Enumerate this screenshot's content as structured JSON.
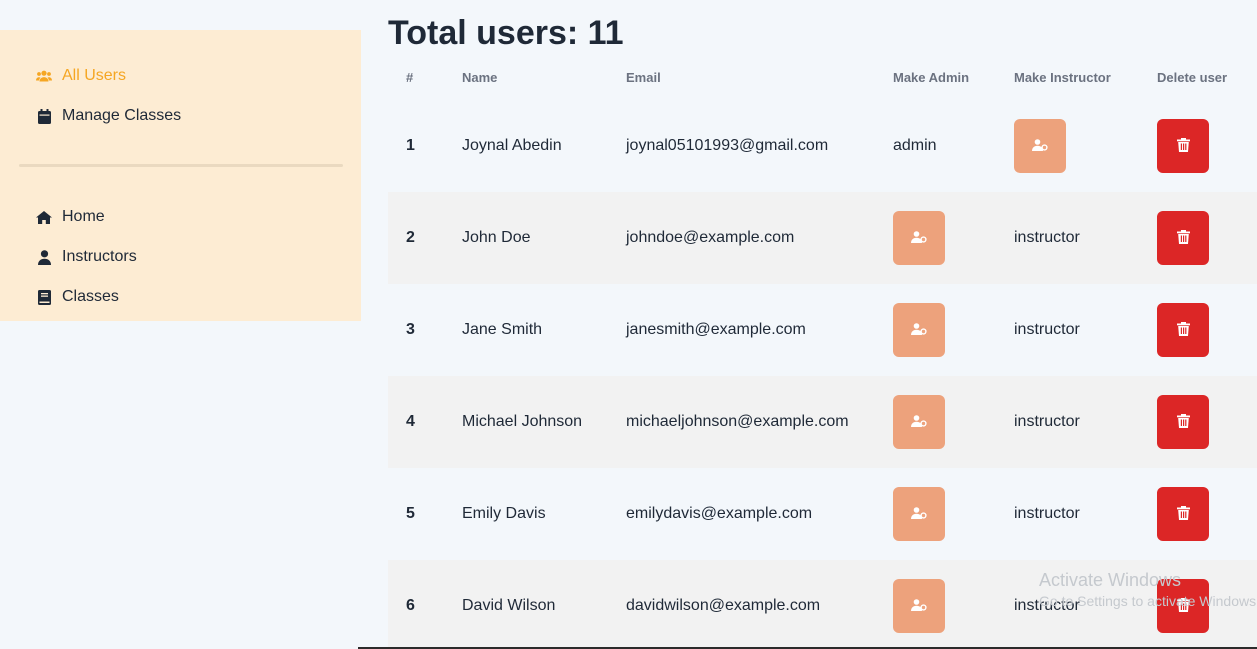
{
  "sidebar": {
    "top_items": [
      {
        "label": "All Users",
        "icon": "users-icon",
        "active": true
      },
      {
        "label": "Manage Classes",
        "icon": "calendar-icon",
        "active": false
      }
    ],
    "bottom_items": [
      {
        "label": "Home",
        "icon": "home-icon"
      },
      {
        "label": "Instructors",
        "icon": "user-icon"
      },
      {
        "label": "Classes",
        "icon": "book-icon"
      }
    ]
  },
  "main": {
    "title": "Total users: 11",
    "columns": [
      "#",
      "Name",
      "Email",
      "Make Admin",
      "Make Instructor",
      "Delete user"
    ],
    "rows": [
      {
        "num": "1",
        "name": "Joynal Abedin",
        "email": "joynal05101993@gmail.com",
        "admin": "admin",
        "instructor": null
      },
      {
        "num": "2",
        "name": "John Doe",
        "email": "johndoe@example.com",
        "admin": null,
        "instructor": "instructor"
      },
      {
        "num": "3",
        "name": "Jane Smith",
        "email": "janesmith@example.com",
        "admin": null,
        "instructor": "instructor"
      },
      {
        "num": "4",
        "name": "Michael Johnson",
        "email": "michaeljohnson@example.com",
        "admin": null,
        "instructor": "instructor"
      },
      {
        "num": "5",
        "name": "Emily Davis",
        "email": "emilydavis@example.com",
        "admin": null,
        "instructor": "instructor"
      },
      {
        "num": "6",
        "name": "David Wilson",
        "email": "davidwilson@example.com",
        "admin": null,
        "instructor": "instructor"
      }
    ]
  },
  "watermark": {
    "line1": "Activate Windows",
    "line2": "Go to Settings to activate Windows."
  },
  "colors": {
    "accent": "#f5a623",
    "sidebar_bg": "#fdecd3",
    "role_button": "#eda27c",
    "delete_button": "#dc2626"
  }
}
